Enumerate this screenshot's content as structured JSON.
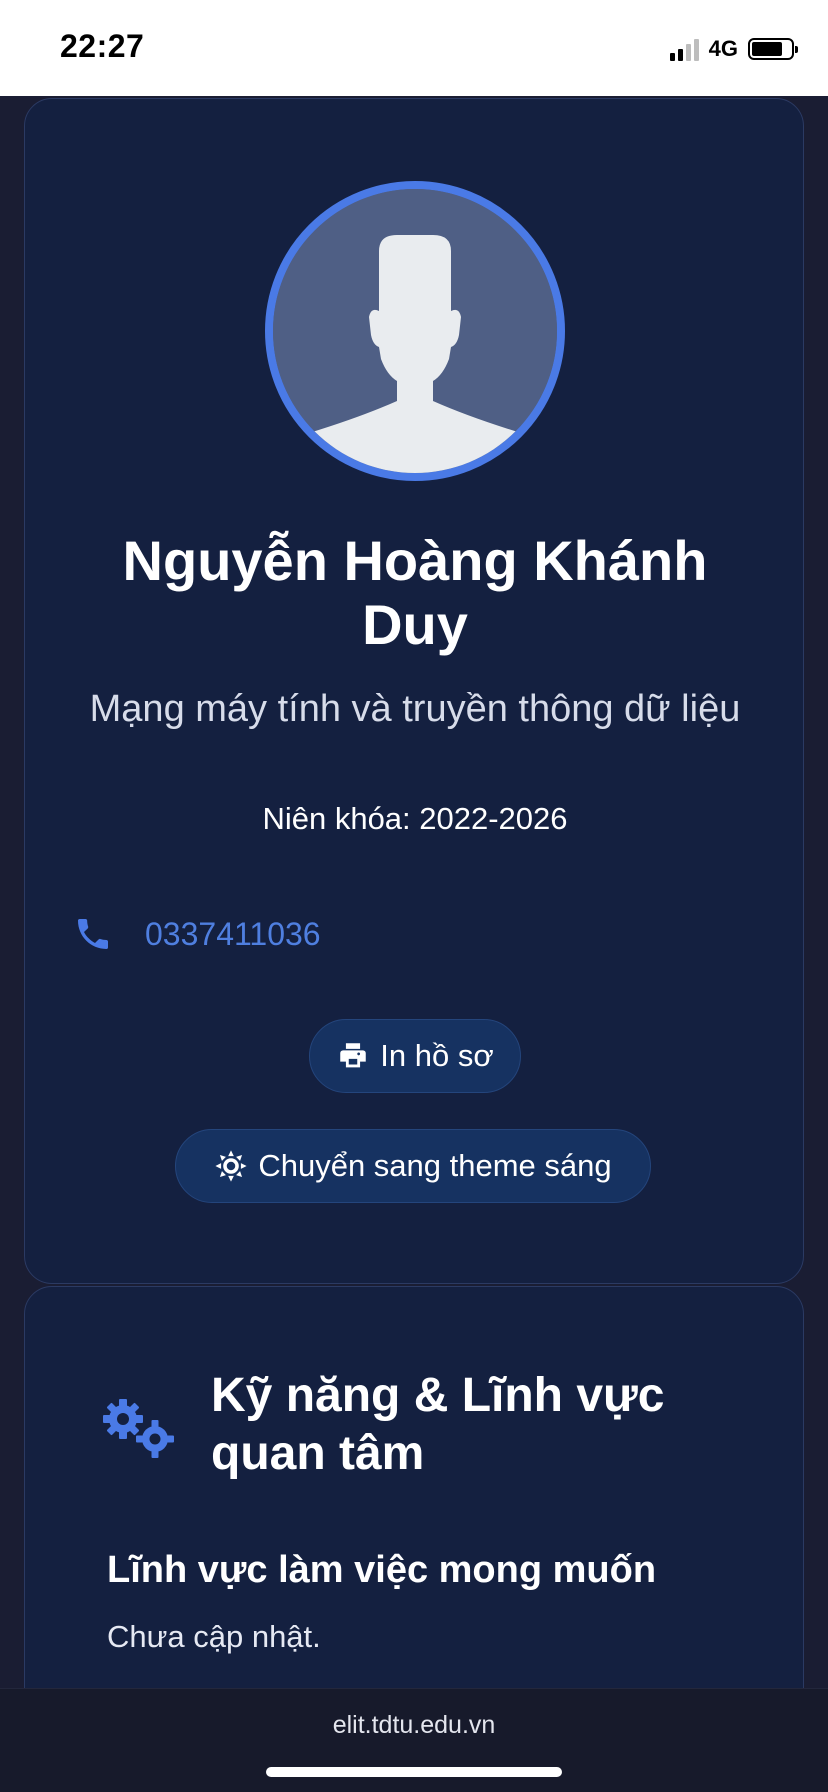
{
  "status_bar": {
    "time": "22:27",
    "network": "4G",
    "signal_icon": "cellular-signal-icon",
    "battery_icon": "battery-icon"
  },
  "profile": {
    "name": "Nguyễn Hoàng Khánh Duy",
    "major": "Mạng máy tính và truyền thông dữ liệu",
    "year_label": "Niên khóa: 2022-2026",
    "phone": "0337411036",
    "phone_icon": "phone-icon",
    "avatar_icon": "default-avatar-icon"
  },
  "actions": {
    "print_label": "In hồ sơ",
    "print_icon": "printer-icon",
    "theme_label": "Chuyển sang theme sáng",
    "theme_icon": "sun-icon"
  },
  "skills": {
    "title": "Kỹ năng & Lĩnh vực quan tâm",
    "icon": "gears-icon",
    "field_heading": "Lĩnh vực làm việc mong muốn",
    "field_value": "Chưa cập nhật."
  },
  "browser": {
    "url": "elit.tdtu.edu.vn"
  },
  "colors": {
    "accent": "#4a7ae6",
    "card_bg": "#142040",
    "page_bg": "#1a1d33",
    "button_bg": "#163261"
  }
}
